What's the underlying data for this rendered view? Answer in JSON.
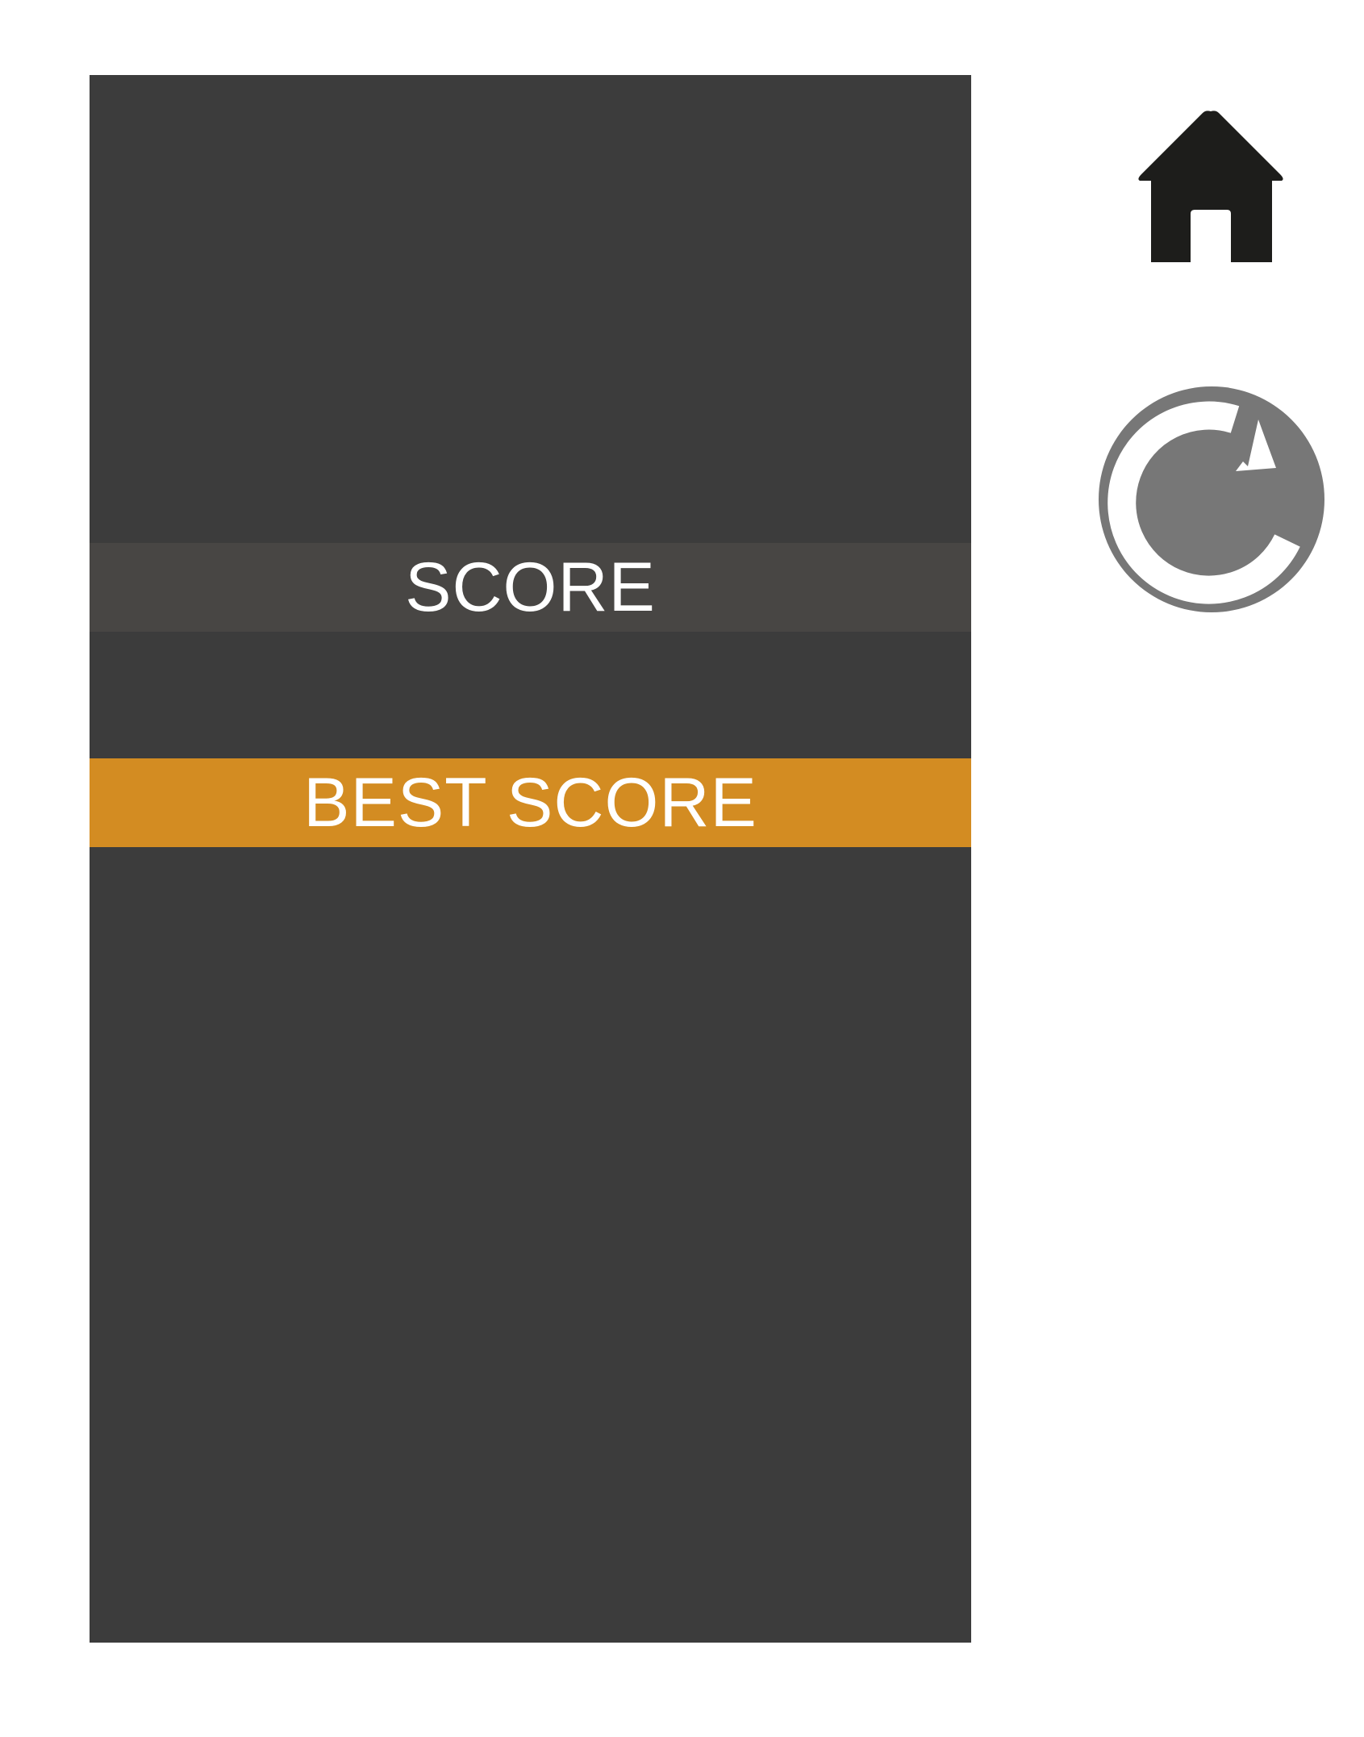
{
  "score_label": "SCORE",
  "best_score_label": "BEST SCORE",
  "icons": {
    "home": "home-icon",
    "restart": "restart-icon"
  },
  "colors": {
    "panel": "#3c3c3c",
    "score_band": "#484644",
    "best_score_band": "#d38c22",
    "home_icon": "#1d1d1b",
    "restart_icon": "#777777",
    "text": "#ffffff"
  }
}
